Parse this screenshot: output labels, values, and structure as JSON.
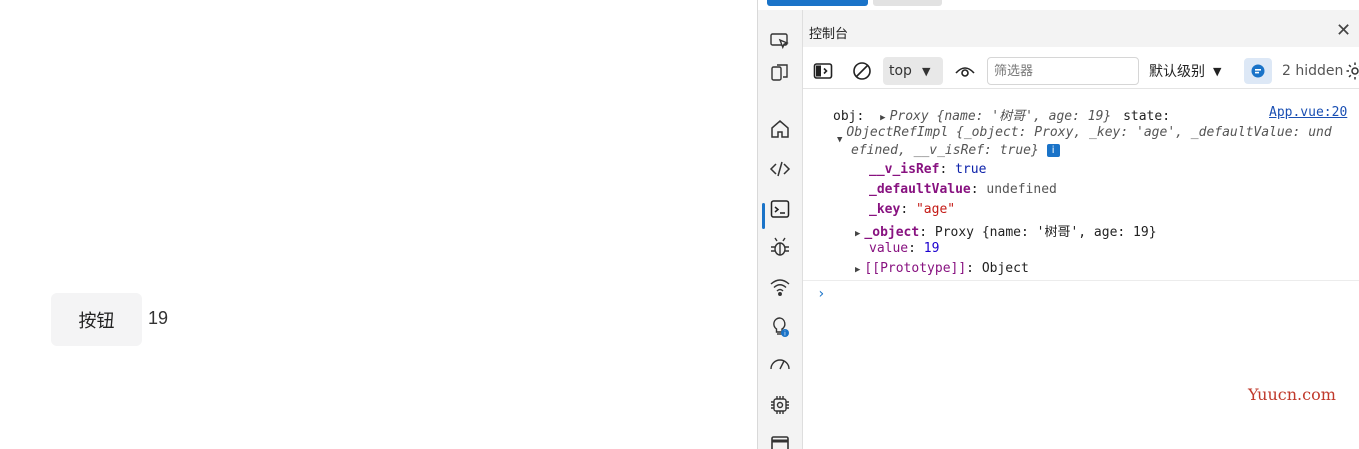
{
  "app": {
    "button_label": "按钮",
    "value": "19"
  },
  "devtools": {
    "panel_title": "控制台",
    "close_glyph": "✕",
    "toolbar": {
      "context": "top",
      "filter_placeholder": "筛选器",
      "level": "默认级别",
      "hidden": "2 hidden"
    },
    "activity_icons": [
      "inspect-icon",
      "device-emulation-icon",
      "welcome-home-icon",
      "elements-icon",
      "console-icon",
      "sources-bug-icon",
      "network-wifi-icon",
      "performance-bulb-icon",
      "performance-gauge-icon",
      "memory-chip-icon",
      "application-icon"
    ],
    "console": {
      "line1": {
        "prefix": "obj:",
        "proxy_italic": "Proxy {name: '树哥', age: 19}",
        "state": "state:",
        "source": "App.vue:20"
      },
      "line2": "ObjectRefImpl {_object: Proxy, _key: 'age', _defaultValue: und",
      "line3": "efined, __v_isRef: true}",
      "props": [
        {
          "key": "__v_isRef",
          "value": "true"
        },
        {
          "key": "_defaultValue",
          "value": "undefined"
        },
        {
          "key": "_key",
          "value": "\"age\""
        },
        {
          "key": "_object",
          "value": "Proxy {name: '树哥', age: 19}"
        },
        {
          "key": "value",
          "value": "19"
        },
        {
          "key": "[[Prototype]]",
          "value": "Object"
        }
      ],
      "prompt": "›"
    }
  },
  "watermark": "Yuucn.com",
  "colors": {
    "accent": "#1a73c8",
    "key": "#881280",
    "string": "#c41a16",
    "number": "#1c00cf",
    "watermark": "#c0392b"
  }
}
